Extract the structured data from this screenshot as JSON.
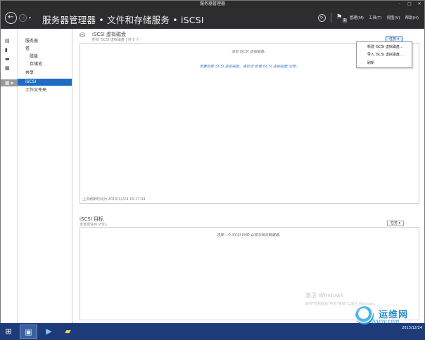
{
  "window": {
    "title": "服务器管理器",
    "controls": [
      "–",
      "□",
      "✕"
    ]
  },
  "header": {
    "breadcrumb": "服务器管理器 • 文件和存储服务 • iSCSI",
    "refresh_icon": "refresh-icon",
    "notifications_badge": "1",
    "menu": {
      "manage": "管理(M)",
      "tools": "工具(T)",
      "view": "视图(V)",
      "help": "帮助(H)"
    }
  },
  "left_rail": {
    "items": [
      "servers-icon",
      "volumes-icon",
      "disks-icon",
      "pools-icon",
      "shares-icon"
    ]
  },
  "nav": {
    "items": [
      {
        "label": "服务器",
        "active": false
      },
      {
        "label": "卷",
        "active": false
      },
      {
        "label": "磁盘",
        "active": false
      },
      {
        "label": "存储池",
        "active": false
      },
      {
        "label": "共享",
        "active": false
      },
      {
        "label": "iSCSI",
        "active": true
      },
      {
        "label": "工作文件夹",
        "active": false
      }
    ]
  },
  "iscsi_panel": {
    "title": "iSCSI 虚拟磁盘",
    "subtitle": "所有 iSCSI 虚拟磁盘 | 共 0 个",
    "tasks_label": "任务",
    "empty_msg": "没有 iSCSI 虚拟磁盘。",
    "create_msg": "若要创建 iSCSI 虚拟磁盘，请启动\"新建 iSCSI 虚拟磁盘\"向导。",
    "last_refresh": "上次刷新时间为 2013/12/24 16:17:34"
  },
  "tasks_menu": {
    "items": [
      "新建 iSCSI 虚拟磁盘...",
      "导入 iSCSI 虚拟磁盘...",
      "刷新"
    ]
  },
  "targets_panel": {
    "title": "iSCSI 目标",
    "subtitle": "未选择任何 VHD。",
    "tasks_label": "任务",
    "empty_msg": "选择一个 iSCSI VHD 以显示相关数据源。"
  },
  "watermark": {
    "line1": "激活 Windows",
    "line2": "转到\"控制面板\"中的\"系统\"以激活 Windows。"
  },
  "taskbar": {
    "clock_time": "",
    "clock_date": "2013/12/24"
  },
  "brand": {
    "name": "运维网",
    "url": "iyunv.com"
  },
  "colors": {
    "accent": "#1e6dc3",
    "header_bg": "#2d2d30",
    "taskbar_bg": "#1d3b78"
  }
}
